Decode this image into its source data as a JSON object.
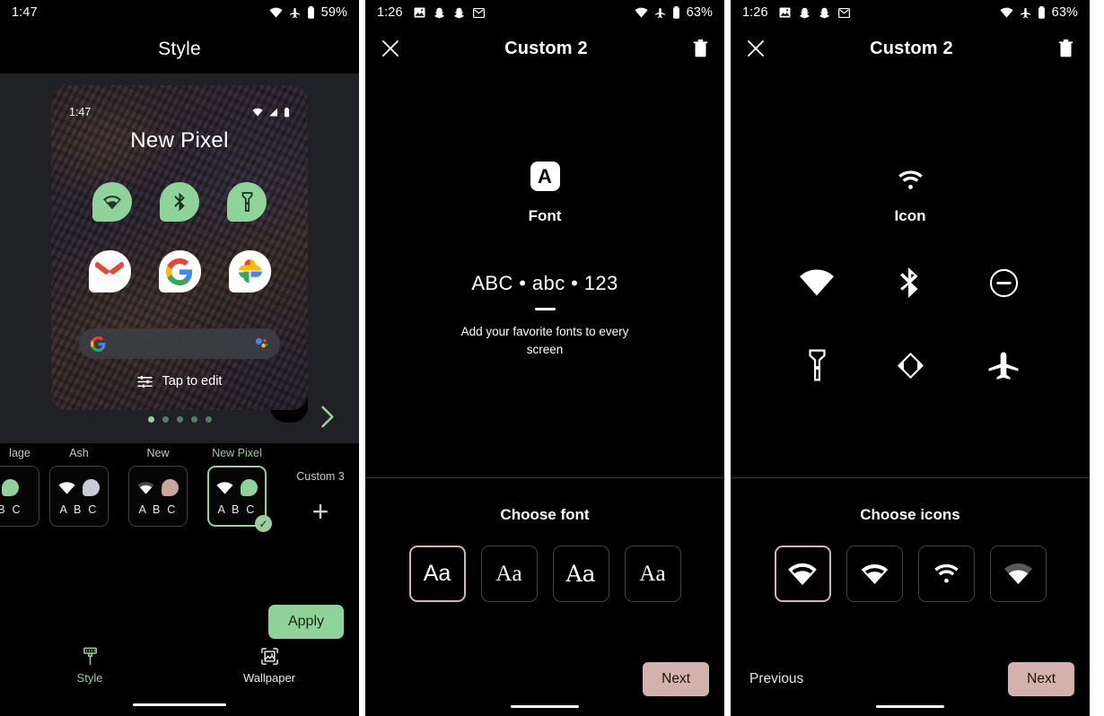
{
  "panel1": {
    "statusbar": {
      "time": "1:47",
      "battery": "59%",
      "icons": [
        "wifi-icon",
        "airplane-icon",
        "battery-icon"
      ]
    },
    "title": "Style",
    "preview": {
      "time": "1:47",
      "device_name": "New Pixel",
      "status_icons": [
        "wifi-icon",
        "signal-icon",
        "battery-icon"
      ],
      "quick_settings": [
        "wifi-icon",
        "bluetooth-icon",
        "flashlight-icon"
      ],
      "quick_settings_color": "#8fd39a",
      "apps": [
        "gmail-icon",
        "google-icon",
        "google-photos-icon"
      ],
      "searchbar": {
        "logo": "google-g-icon",
        "assistant": "assistant-icon"
      },
      "edit_hint": "Tap to edit"
    },
    "pager": {
      "total": 5,
      "active": 1
    },
    "cards": [
      {
        "label": "lage",
        "abc": "B C",
        "clipped": true,
        "selected": false,
        "swatch": "#8fd39a",
        "has_wifi": false
      },
      {
        "label": "Ash",
        "abc": "A B C",
        "clipped": false,
        "selected": false,
        "swatch": "#c6cdd6",
        "has_wifi": true
      },
      {
        "label": "New",
        "abc": "A B C",
        "clipped": false,
        "selected": false,
        "swatch": "#c8a59e",
        "has_wifi": true
      },
      {
        "label": "New Pixel",
        "abc": "A B C",
        "clipped": false,
        "selected": true,
        "swatch": "#8fd39a",
        "has_wifi": true
      }
    ],
    "add_card": {
      "label": "Custom 3",
      "plus": "+"
    },
    "apply_label": "Apply",
    "nav": [
      {
        "label": "Style",
        "icon": "paint-brush-icon",
        "active": true
      },
      {
        "label": "Wallpaper",
        "icon": "image-icon",
        "active": false
      }
    ],
    "accent_color": "#9ccc9f"
  },
  "panel2": {
    "statusbar": {
      "time": "1:26",
      "battery": "63%",
      "notifications": [
        "photo-icon",
        "snapchat-icon",
        "snapchat-icon",
        "gmail-icon"
      ],
      "icons": [
        "wifi-icon",
        "airplane-icon",
        "battery-icon"
      ]
    },
    "appbar": {
      "close": "close-icon",
      "title": "Custom 2",
      "delete": "trash-icon"
    },
    "hero": {
      "badge_letter": "A",
      "title": "Font",
      "sample": "ABC • abc • 123",
      "description": "Add your favorite fonts to every screen"
    },
    "chooser": {
      "title": "Choose font",
      "options": [
        {
          "label": "Aa",
          "style": "sans",
          "selected": true
        },
        {
          "label": "Aa",
          "style": "serif",
          "selected": false
        },
        {
          "label": "Aa",
          "style": "serif2",
          "selected": false
        },
        {
          "label": "Aa",
          "style": "serif",
          "selected": false
        }
      ]
    },
    "actions": {
      "next_label": "Next"
    },
    "accent_color": "#d3b2ab"
  },
  "panel3": {
    "statusbar": {
      "time": "1:26",
      "battery": "63%",
      "notifications": [
        "photo-icon",
        "snapchat-icon",
        "snapchat-icon",
        "gmail-icon"
      ],
      "icons": [
        "wifi-icon",
        "airplane-icon",
        "battery-icon"
      ]
    },
    "appbar": {
      "close": "close-icon",
      "title": "Custom 2",
      "delete": "trash-icon"
    },
    "hero": {
      "badge_icon": "wifi-icon",
      "title": "Icon",
      "grid_icons": [
        "wifi-icon",
        "bluetooth-icon",
        "do-not-disturb-icon",
        "flashlight-icon",
        "auto-rotate-icon",
        "airplane-icon"
      ]
    },
    "chooser": {
      "title": "Choose icons",
      "options": [
        {
          "variant": "wifi-filled-outline",
          "selected": true
        },
        {
          "variant": "wifi-filled",
          "selected": false
        },
        {
          "variant": "wifi-arcs",
          "selected": false
        },
        {
          "variant": "wifi-gray-arc",
          "selected": false
        }
      ]
    },
    "actions": {
      "previous_label": "Previous",
      "next_label": "Next"
    },
    "accent_color": "#d3b2ab"
  }
}
